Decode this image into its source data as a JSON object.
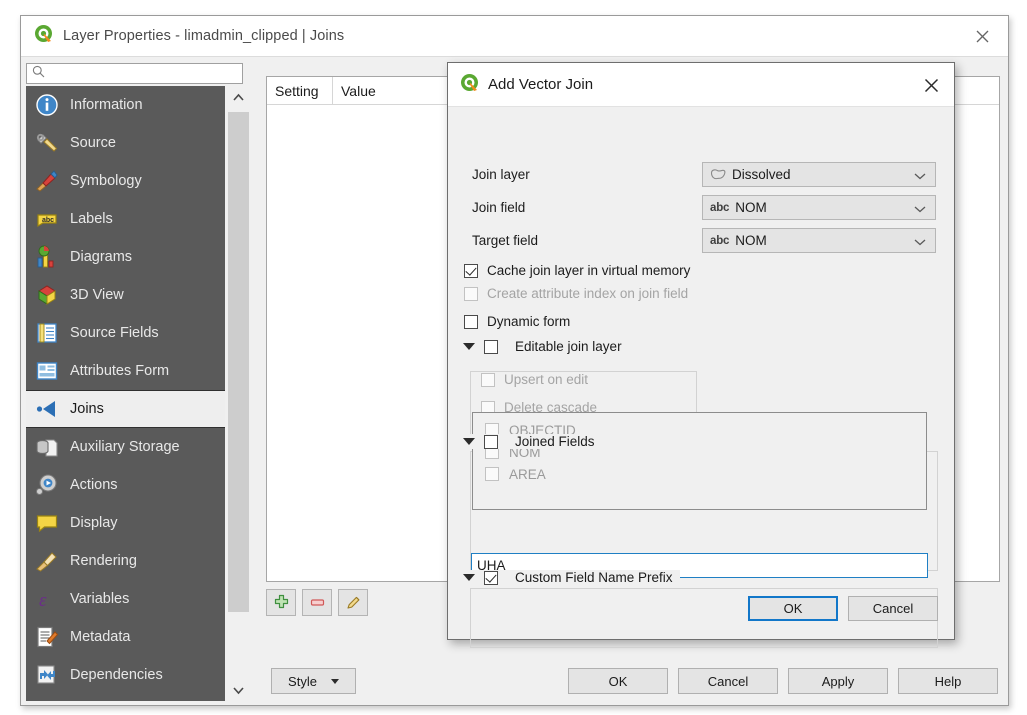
{
  "window": {
    "title": "Layer Properties - limadmin_clipped | Joins",
    "close_label": "×",
    "logo_name": "qgis-logo"
  },
  "search": {
    "value": "",
    "placeholder": ""
  },
  "sidebar": {
    "items": [
      {
        "label": "Information",
        "icon": "information-icon",
        "selected": false
      },
      {
        "label": "Source",
        "icon": "source-icon",
        "selected": false
      },
      {
        "label": "Symbology",
        "icon": "symbology-icon",
        "selected": false
      },
      {
        "label": "Labels",
        "icon": "labels-icon",
        "selected": false
      },
      {
        "label": "Diagrams",
        "icon": "diagrams-icon",
        "selected": false
      },
      {
        "label": "3D View",
        "icon": "3d-view-icon",
        "selected": false
      },
      {
        "label": "Source Fields",
        "icon": "source-fields-icon",
        "selected": false
      },
      {
        "label": "Attributes Form",
        "icon": "attributes-form-icon",
        "selected": false
      },
      {
        "label": "Joins",
        "icon": "joins-icon",
        "selected": true
      },
      {
        "label": "Auxiliary Storage",
        "icon": "auxiliary-storage-icon",
        "selected": false
      },
      {
        "label": "Actions",
        "icon": "actions-icon",
        "selected": false
      },
      {
        "label": "Display",
        "icon": "display-icon",
        "selected": false
      },
      {
        "label": "Rendering",
        "icon": "rendering-icon",
        "selected": false
      },
      {
        "label": "Variables",
        "icon": "variables-icon",
        "selected": false
      },
      {
        "label": "Metadata",
        "icon": "metadata-icon",
        "selected": false
      },
      {
        "label": "Dependencies",
        "icon": "dependencies-icon",
        "selected": false
      }
    ]
  },
  "joins_panel": {
    "columns": [
      "Setting",
      "Value"
    ],
    "rows": [],
    "toolbar": {
      "add_label": "add-join",
      "remove_label": "remove-join",
      "edit_label": "edit-join"
    }
  },
  "footer": {
    "style_label": "Style",
    "buttons": [
      "OK",
      "Cancel",
      "Apply",
      "Help"
    ]
  },
  "dialog": {
    "title": "Add Vector Join",
    "close_label": "×",
    "fields": [
      {
        "label": "Join layer",
        "value": "Dissolved",
        "icon": "polygon-layer-icon"
      },
      {
        "label": "Join field",
        "value": "NOM",
        "icon": "abc-text-field-icon"
      },
      {
        "label": "Target field",
        "value": "NOM",
        "icon": "abc-text-field-icon"
      }
    ],
    "options": [
      {
        "label": "Cache join layer in virtual memory",
        "checked": true,
        "disabled": false
      },
      {
        "label": "Create attribute index on join field",
        "checked": false,
        "disabled": true
      },
      {
        "label": "Dynamic form",
        "checked": false,
        "disabled": false
      }
    ],
    "editable_group": {
      "label": "Editable join layer",
      "checked": false,
      "children": [
        {
          "label": "Upsert on edit",
          "checked": false,
          "disabled": true
        },
        {
          "label": "Delete cascade",
          "checked": false,
          "disabled": true
        }
      ]
    },
    "joined_fields_group": {
      "label": "Joined Fields",
      "checked": false,
      "fields": [
        {
          "label": "OBJECTID",
          "checked": false,
          "disabled": true
        },
        {
          "label": "NOM",
          "checked": false,
          "disabled": true
        },
        {
          "label": "AREA",
          "checked": false,
          "disabled": true
        }
      ]
    },
    "prefix_group": {
      "label": "Custom Field Name Prefix",
      "checked": true,
      "value": "UHA_",
      "placeholder": ""
    },
    "buttons": {
      "ok": "OK",
      "cancel": "Cancel"
    }
  },
  "colors": {
    "sidebar_bg": "#5a5a5a",
    "sidebar_selected_bg": "#eeeeee",
    "accent_focus": "#1277c9",
    "dialog_bg": "#f0f0f0",
    "input_focus_border": "#1f7fc4"
  }
}
